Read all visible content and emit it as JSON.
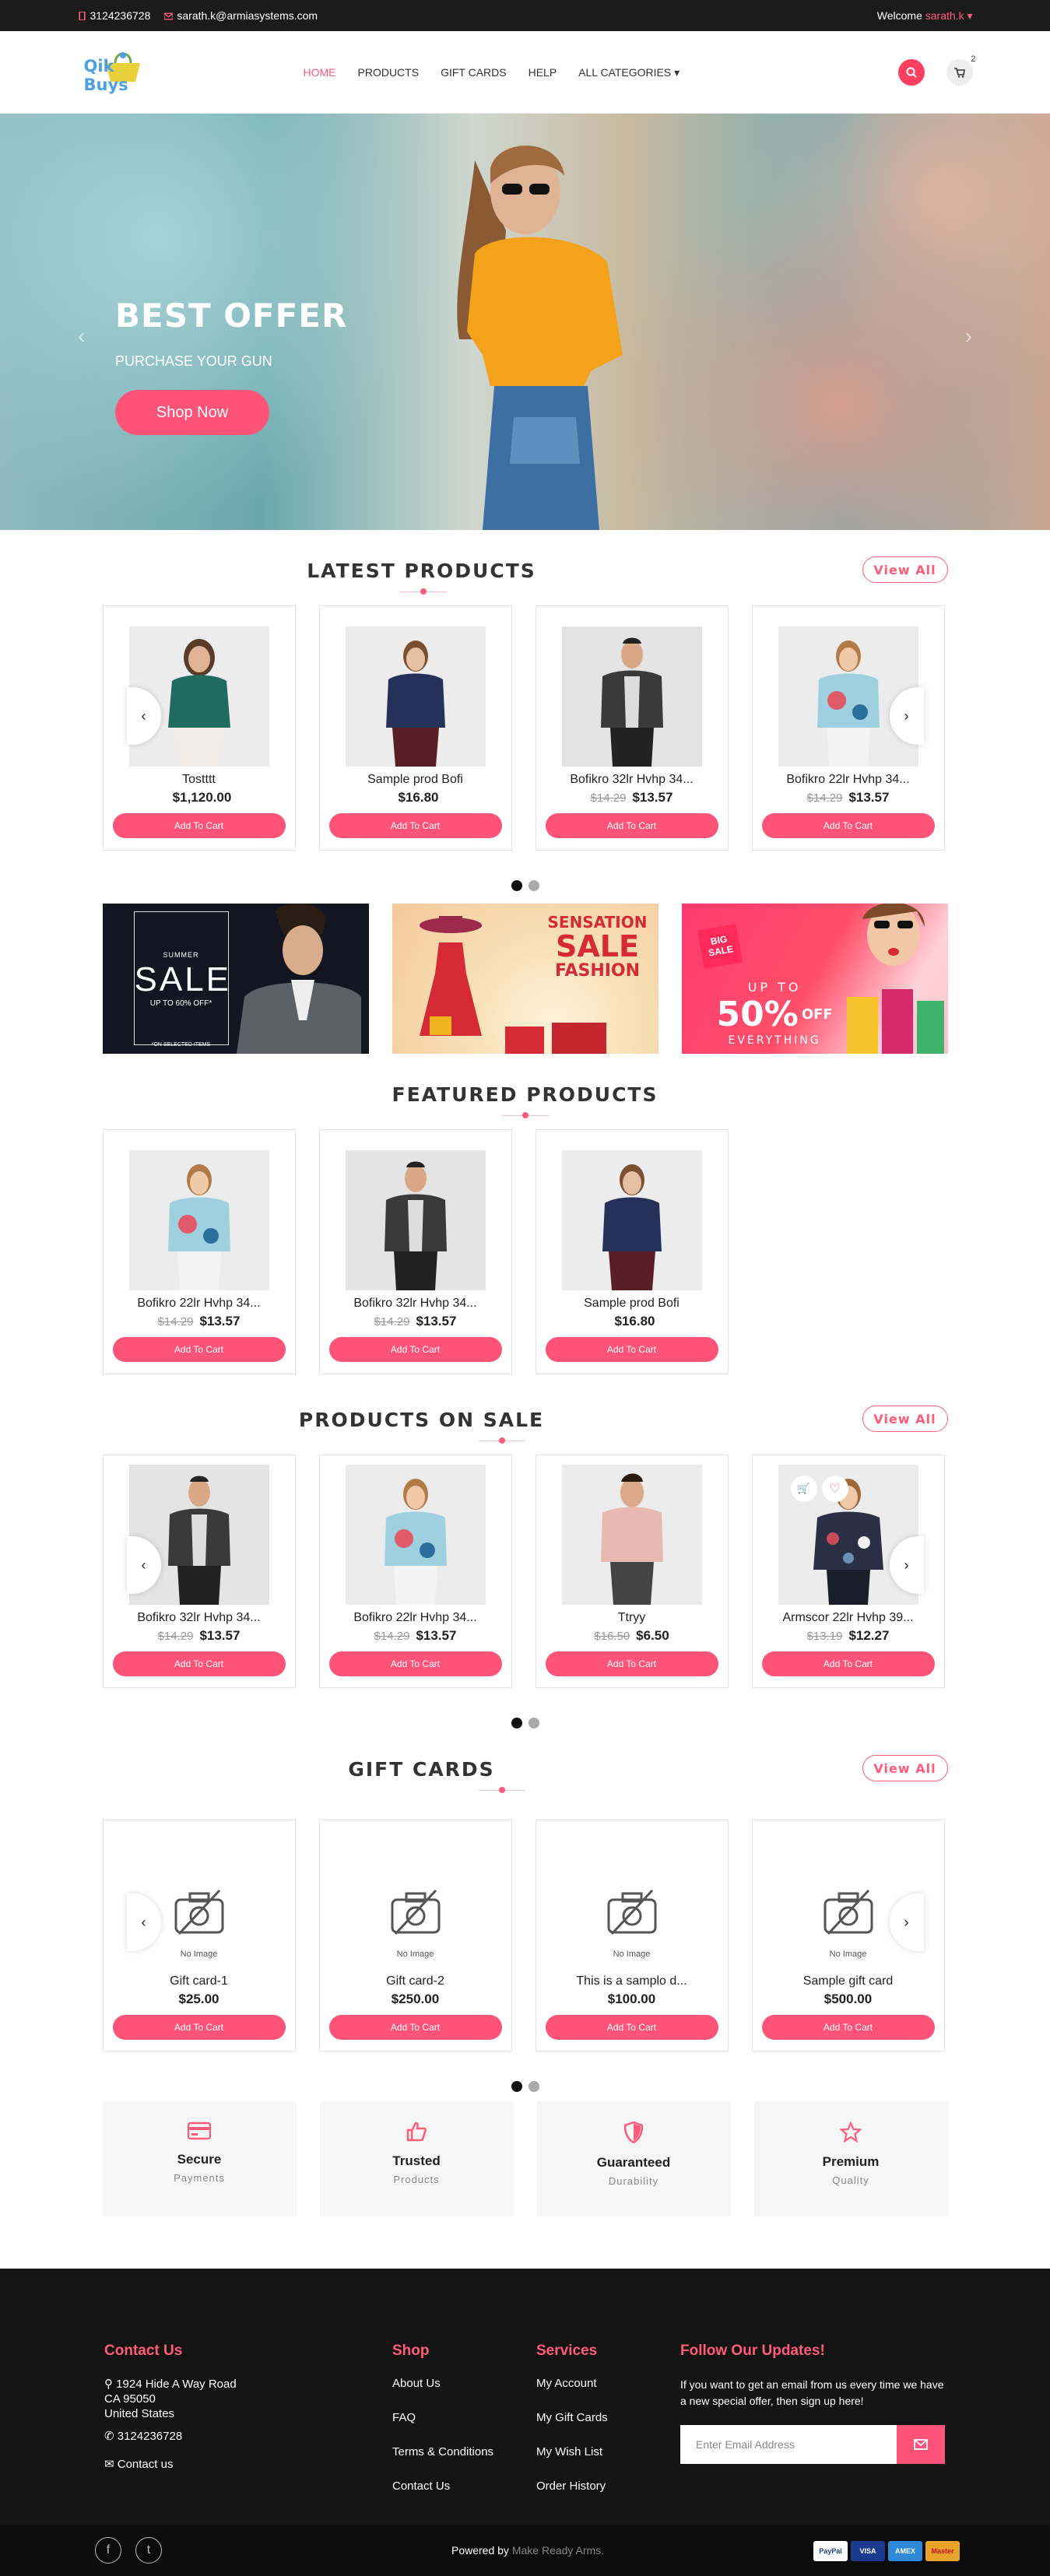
{
  "topbar": {
    "phone": "3124236728",
    "email": "sarath.k@armiasystems.com",
    "welcome": "Welcome",
    "user": "sarath.k"
  },
  "header": {
    "logo_text": "Qik Buys",
    "nav": [
      "HOME",
      "PRODUCTS",
      "GIFT CARDS",
      "HELP",
      "ALL CATEGORIES"
    ],
    "cart_count": "2"
  },
  "hero": {
    "title": "BEST OFFER",
    "subtitle": "PURCHASE YOUR GUN",
    "button": "Shop Now"
  },
  "latest": {
    "title": "LATEST PRODUCTS",
    "view_all": "View All",
    "items": [
      {
        "name": "Tostttt",
        "old": "",
        "price": "$1,120.00",
        "btn": "Add To Cart"
      },
      {
        "name": "Sample prod Bofi",
        "old": "",
        "price": "$16.80",
        "btn": "Add To Cart"
      },
      {
        "name": "Bofikro 32lr Hvhp 34...",
        "old": "$14.29",
        "price": "$13.57",
        "btn": "Add To Cart"
      },
      {
        "name": "Bofikro 22lr Hvhp 34...",
        "old": "$14.29",
        "price": "$13.57",
        "btn": "Add To Cart"
      }
    ]
  },
  "banners": {
    "b1": {
      "small": "SUMMER",
      "big": "SALE",
      "line": "UP TO 60% OFF*",
      "note": "*ON SELECTED ITEMS"
    },
    "b2": {
      "l1": "SENSATION",
      "l2": "SALE",
      "l3": "FASHION"
    },
    "b3": {
      "tag1": "BIG",
      "tag2": "SALE",
      "upto": "UP TO",
      "pct": "50%",
      "off": "OFF",
      "every": "EVERYTHING"
    }
  },
  "featured": {
    "title": "FEATURED PRODUCTS",
    "items": [
      {
        "name": "Bofikro 22lr Hvhp 34...",
        "old": "$14.29",
        "price": "$13.57",
        "btn": "Add To Cart"
      },
      {
        "name": "Bofikro 32lr Hvhp 34...",
        "old": "$14.29",
        "price": "$13.57",
        "btn": "Add To Cart"
      },
      {
        "name": "Sample prod Bofi",
        "old": "",
        "price": "$16.80",
        "btn": "Add To Cart"
      }
    ]
  },
  "sale": {
    "title": "PRODUCTS ON SALE",
    "view_all": "View All",
    "items": [
      {
        "name": "Bofikro 32lr Hvhp 34...",
        "old": "$14.29",
        "price": "$13.57",
        "btn": "Add To Cart"
      },
      {
        "name": "Bofikro 22lr Hvhp 34...",
        "old": "$14.29",
        "price": "$13.57",
        "btn": "Add To Cart"
      },
      {
        "name": "Ttryy",
        "old": "$16.50",
        "price": "$6.50",
        "btn": "Add To Cart"
      },
      {
        "name": "Armscor 22lr Hvhp 39...",
        "old": "$13.19",
        "price": "$12.27",
        "btn": "Add To Cart"
      }
    ]
  },
  "gift": {
    "title": "GIFT CARDS",
    "view_all": "View All",
    "no_image": "No Image",
    "items": [
      {
        "name": "Gift card-1",
        "price": "$25.00",
        "btn": "Add To Cart"
      },
      {
        "name": "Gift card-2",
        "price": "$250.00",
        "btn": "Add To Cart"
      },
      {
        "name": "This is a samplo d...",
        "price": "$100.00",
        "btn": "Add To Cart"
      },
      {
        "name": "Sample gift card",
        "price": "$500.00",
        "btn": "Add To Cart"
      }
    ]
  },
  "features": [
    {
      "title": "Secure",
      "sub": "Payments",
      "icon": "credit-card-icon"
    },
    {
      "title": "Trusted",
      "sub": "Products",
      "icon": "thumbs-up-icon"
    },
    {
      "title": "Guaranteed",
      "sub": "Durability",
      "icon": "shield-icon"
    },
    {
      "title": "Premium",
      "sub": "Quality",
      "icon": "star-icon"
    }
  ],
  "footer": {
    "contact_title": "Contact Us",
    "addr1": "1924 Hide A Way Road",
    "addr2": "CA 95050",
    "addr3": "United States",
    "phone": "3124236728",
    "contact_link": "Contact us",
    "shop_title": "Shop",
    "shop_links": [
      "About Us",
      "FAQ",
      "Terms & Conditions",
      "Contact Us"
    ],
    "services_title": "Services",
    "services_links": [
      "My Account",
      "My Gift Cards",
      "My Wish List",
      "Order History"
    ],
    "follow_title": "Follow Our Updates!",
    "follow_text": "If you want to get an email from us every time we have a new special offer, then sign up here!",
    "email_placeholder": "Enter Email Address",
    "powered": "Powered by",
    "powered_brand": "Make Ready Arms.",
    "payments": [
      "PayPal",
      "VISA",
      "AMEX",
      "Master"
    ]
  },
  "colors": {
    "accent": "#ff5477",
    "dark": "#141414"
  }
}
